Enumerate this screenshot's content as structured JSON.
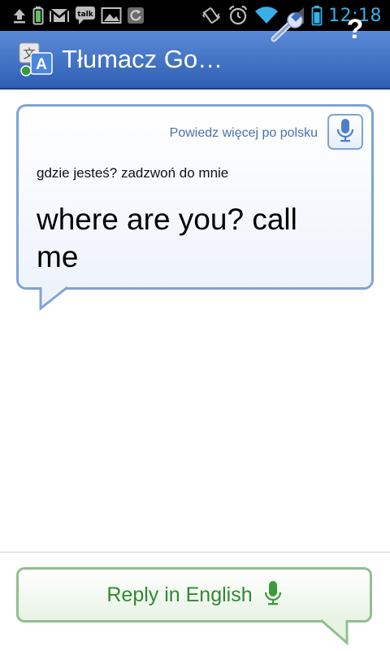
{
  "status_bar": {
    "time": "12:18",
    "notification_talk_label": "talk",
    "icons": [
      "upload-icon",
      "battery-notification-icon",
      "gmail-icon",
      "talk-icon",
      "gallery-icon",
      "sync-icon",
      "vibrate-icon",
      "alarm-icon",
      "wifi-icon",
      "signal-icon",
      "battery-icon"
    ]
  },
  "action_bar": {
    "title": "Tłumacz Go…",
    "icons": [
      "translate-app-icon",
      "wrench-icon"
    ],
    "help_label": "?"
  },
  "conversation": {
    "speak_more_label": "Powiedz więcej po polsku",
    "source_text": "gdzie jesteś? zadzwoń do mnie",
    "translated_text": "where are you? call me"
  },
  "reply": {
    "label": "Reply in English"
  },
  "colors": {
    "action_bar": "#3d6cc0",
    "bubble_border": "#7fa4d6",
    "reply_border": "#8fc08f",
    "reply_text": "#2f8a2f",
    "status_time": "#3aaee6"
  }
}
